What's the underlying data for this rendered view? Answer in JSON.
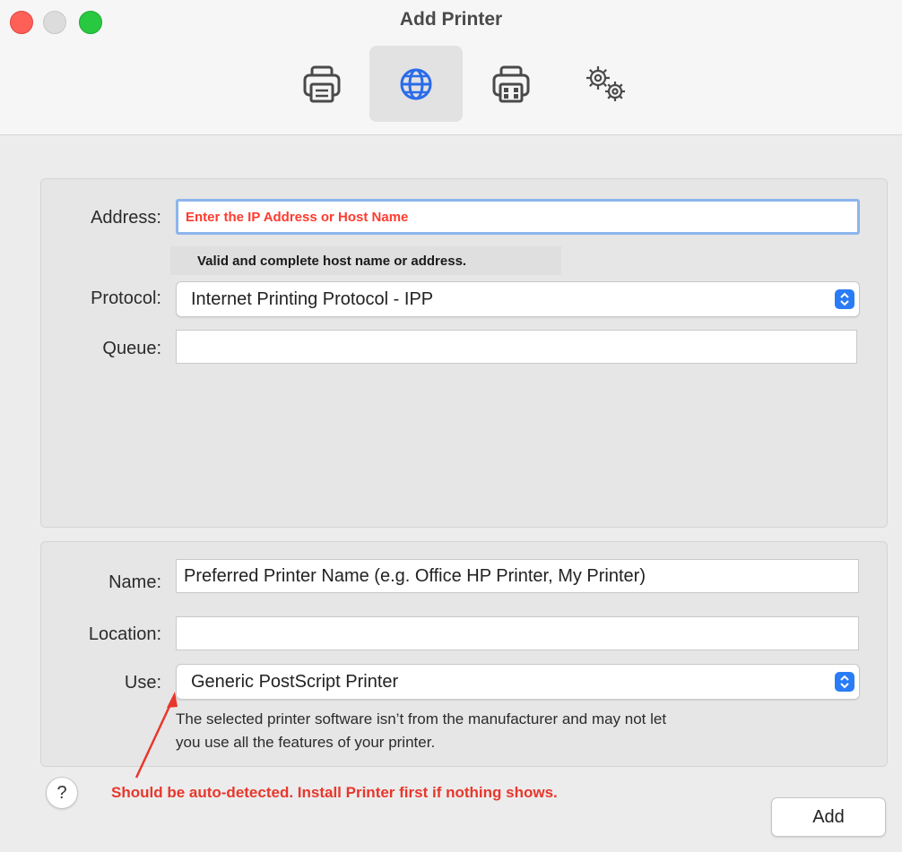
{
  "window": {
    "title": "Add Printer"
  },
  "toolbar": {
    "items": [
      {
        "icon": "printer-icon",
        "selected": false
      },
      {
        "icon": "globe-icon",
        "selected": true
      },
      {
        "icon": "fax-printer-icon",
        "selected": false
      },
      {
        "icon": "gear-icon",
        "selected": false
      }
    ]
  },
  "ip_panel": {
    "address_label": "Address:",
    "address_value": "Enter the IP Address or Host Name",
    "address_hint": "Valid and complete host name or address.",
    "protocol_label": "Protocol:",
    "protocol_value": "Internet Printing Protocol - IPP",
    "queue_label": "Queue:",
    "queue_value": ""
  },
  "details_panel": {
    "name_label": "Name:",
    "name_value": "Preferred Printer Name (e.g. Office HP Printer, My Printer)",
    "location_label": "Location:",
    "location_value": "",
    "use_label": "Use:",
    "use_value": "Generic PostScript Printer",
    "use_note_line1": "The selected printer software isn’t from the manufacturer and may not let",
    "use_note_line2": "you use all the features of your printer."
  },
  "footer": {
    "help_label": "?",
    "annotation": "Should be auto-detected. Install Printer first if nothing shows.",
    "add_label": "Add"
  },
  "colors": {
    "accent": "#2a7cf6",
    "annotation": "#e8372c",
    "focus_ring": "#8cb5ec"
  }
}
